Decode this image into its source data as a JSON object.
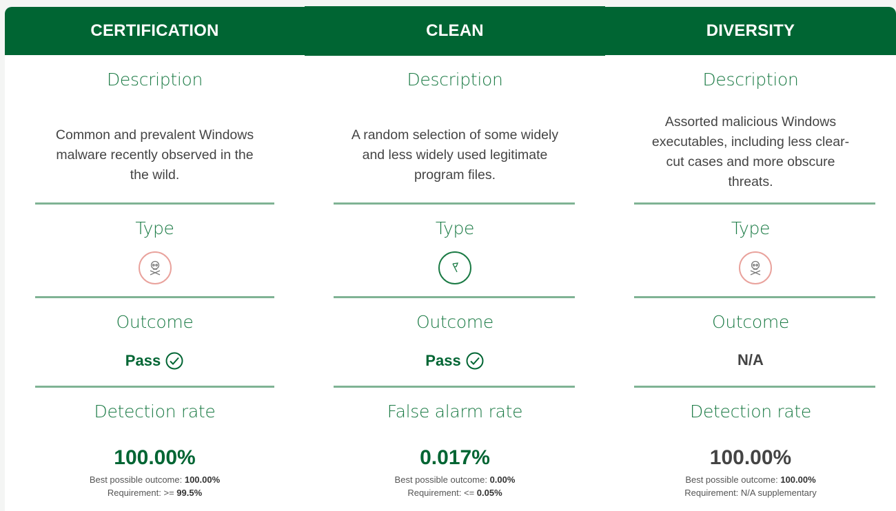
{
  "columns": [
    {
      "header": "CERTIFICATION",
      "description_title": "Description",
      "description_lines": [
        "Common and prevalent Windows",
        "malware recently observed in the",
        "the wild."
      ],
      "type_title": "Type",
      "type_icon": "skull-crossbones-icon",
      "outcome_title": "Outcome",
      "outcome": "Pass",
      "rate_title": "Detection rate",
      "rate_value": "100.00%",
      "best_label": "Best possible outcome: ",
      "best_value": "100.00%",
      "req_label": "Requirement: >= ",
      "req_value": "99.5%"
    },
    {
      "header": "CLEAN",
      "description_title": "Description",
      "description_lines": [
        "A random selection of some widely",
        "and less widely used legitimate",
        "program files."
      ],
      "type_title": "Type",
      "type_icon": "clean-flag-icon",
      "outcome_title": "Outcome",
      "outcome": "Pass",
      "rate_title": "False alarm rate",
      "rate_value": "0.017%",
      "best_label": "Best possible outcome: ",
      "best_value": "0.00%",
      "req_label": "Requirement: <= ",
      "req_value": "0.05%"
    },
    {
      "header": "DIVERSITY",
      "description_title": "Description",
      "description_lines": [
        "Assorted malicious Windows",
        "executables, including less clear-",
        "cut cases and more obscure",
        "threats."
      ],
      "type_title": "Type",
      "type_icon": "skull-crossbones-icon",
      "outcome_title": "Outcome",
      "outcome": "N/A",
      "rate_title": "Detection rate",
      "rate_value": "100.00%",
      "best_label": "Best possible outcome: ",
      "best_value": "100.00%",
      "req_label": "Requirement: N/A supplementary",
      "req_value": ""
    }
  ],
  "colors": {
    "header_green": "#006533",
    "title_green": "#1a7a44",
    "divider": "#7fb394",
    "malicious_ring": "#e9a29c"
  }
}
